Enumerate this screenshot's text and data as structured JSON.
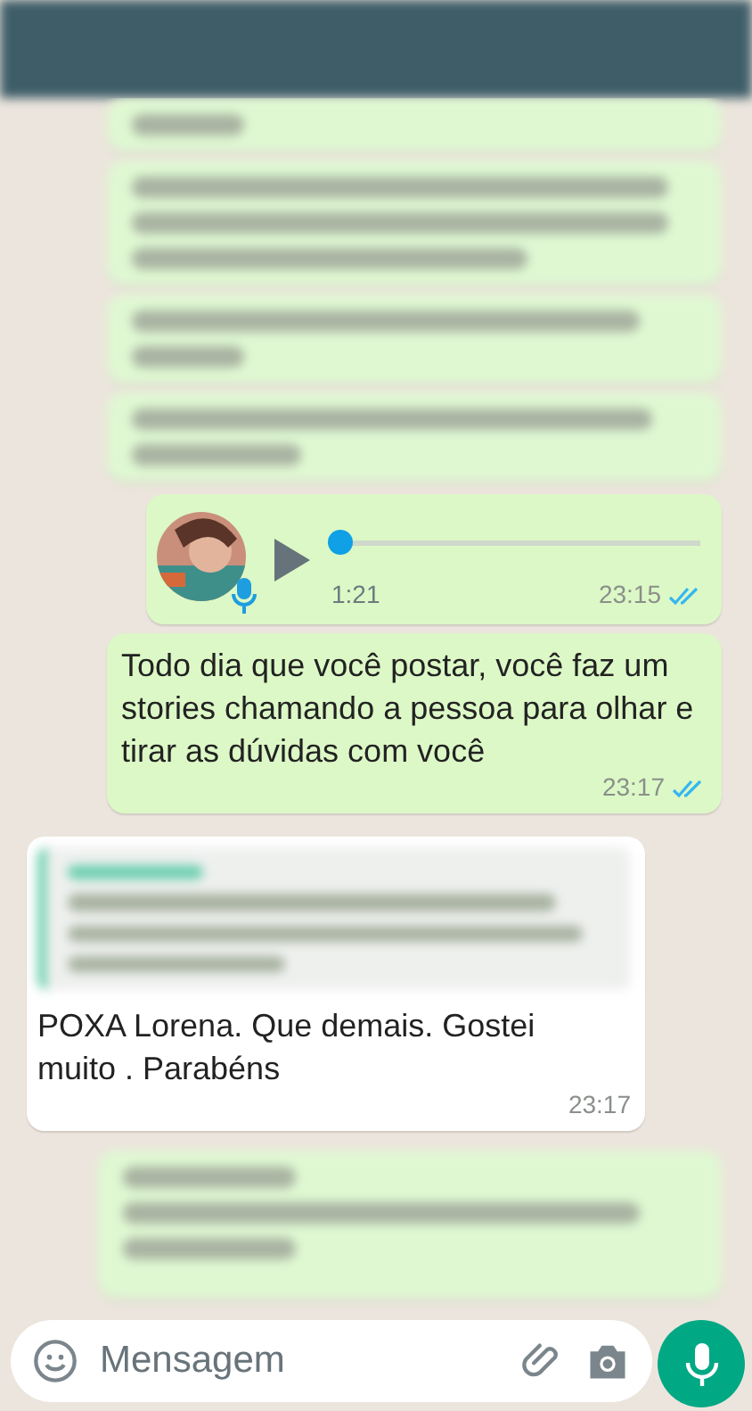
{
  "voice_message": {
    "duration": "1:21",
    "time": "23:15",
    "read": true,
    "level": 0
  },
  "messages": [
    {
      "kind": "sent",
      "text": "Todo dia que você postar, você faz um stories chamando a pessoa para olhar e tirar as dúvidas com você",
      "time": "23:17",
      "read": true
    },
    {
      "kind": "received",
      "text": "POXA Lorena. Que demais. Gostei muito . Parabéns",
      "time": "23:17"
    }
  ],
  "composer": {
    "placeholder": "Mensagem"
  }
}
